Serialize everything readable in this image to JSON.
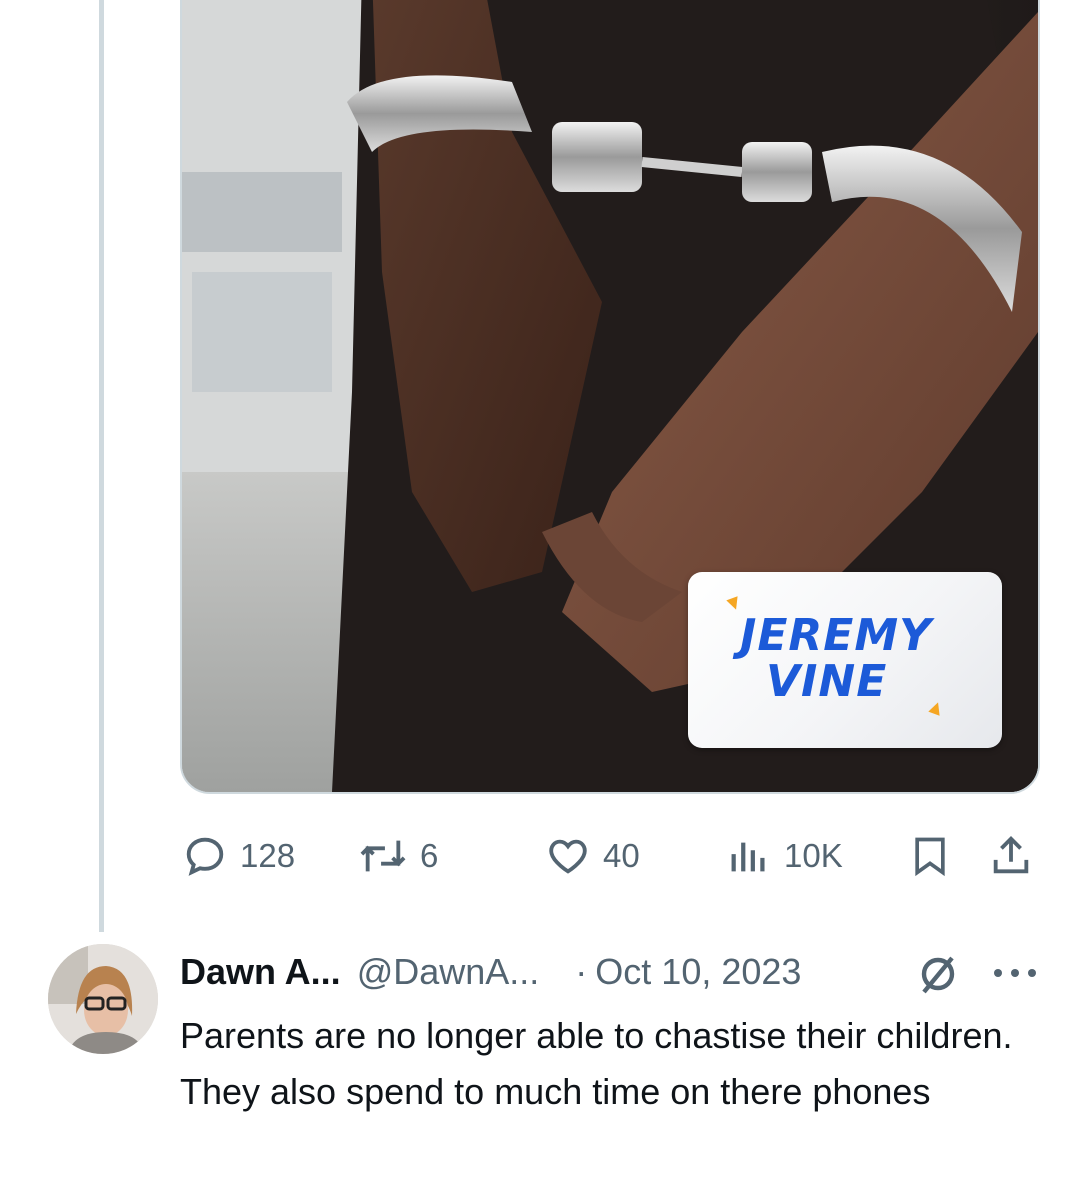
{
  "media": {
    "logo_line1": "JEREMY",
    "logo_line2": "VINE"
  },
  "tweet_actions": {
    "replies": "128",
    "reposts": "6",
    "likes": "40",
    "views": "10K"
  },
  "reply": {
    "display_name": "Dawn A...",
    "handle": "@DawnA...",
    "separator": "·",
    "date": "Oct 10, 2023",
    "text": "Parents are no longer able to chastise their children. They also spend to much time on there phones"
  },
  "icons": {
    "reply": "speech-bubble-icon",
    "repost": "repost-arrows-icon",
    "like": "heart-icon",
    "views": "bar-chart-icon",
    "bookmark": "bookmark-icon",
    "share": "share-upload-icon",
    "grok": "grok-slash-circle-icon",
    "more": "more-dots-icon"
  },
  "colors": {
    "text_primary": "#0f1419",
    "text_secondary": "#536471",
    "border": "#cfd9de",
    "logo_blue": "#1c5ad8",
    "logo_accent": "#f5a623"
  }
}
